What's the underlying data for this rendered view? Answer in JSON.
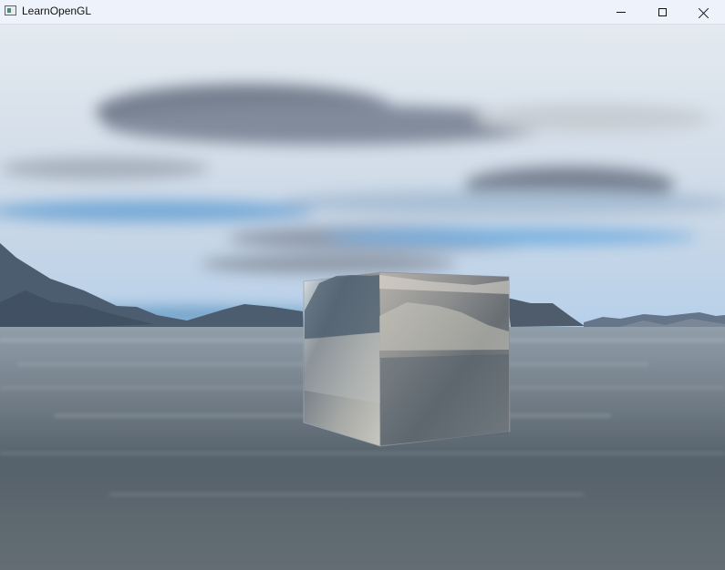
{
  "window": {
    "title": "LearnOpenGL"
  },
  "viewport": {
    "description_icon": "opengl-scene"
  },
  "colors": {
    "titlebar": "#eef3fb",
    "sky_top": "#dfe6ee",
    "sky_blue": "#6fa7d6",
    "water": "#707b86",
    "cube_light": "#c8c8c2",
    "cube_dark": "#62686d"
  }
}
